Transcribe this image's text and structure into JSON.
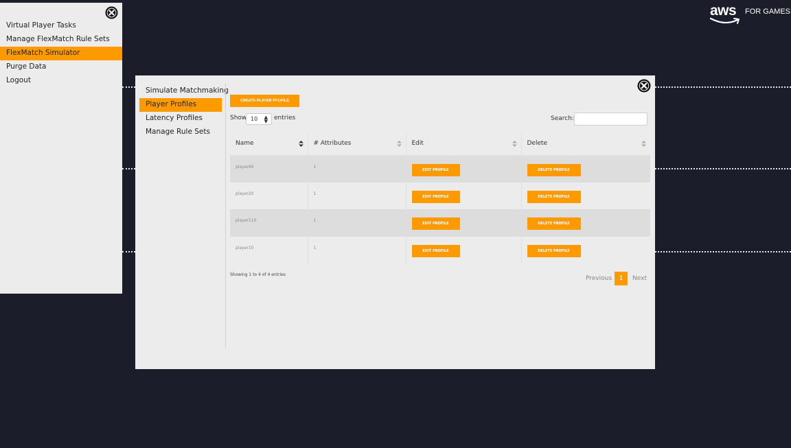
{
  "brand": {
    "logo_word": "aws",
    "tagline": "FOR GAMES"
  },
  "sidemenu": {
    "items": [
      {
        "label": "Virtual Player Tasks"
      },
      {
        "label": "Manage FlexMatch Rule Sets"
      },
      {
        "label": "FlexMatch Simulator"
      },
      {
        "label": "Purge Data"
      },
      {
        "label": "Logout"
      }
    ],
    "active_index": 2
  },
  "modal": {
    "nav": [
      {
        "label": "Simulate Matchmaking"
      },
      {
        "label": "Player Profiles"
      },
      {
        "label": "Latency Profiles"
      },
      {
        "label": "Manage Rule Sets"
      }
    ],
    "active_index": 1,
    "create_button": "CREATE PLAYER PROFILE",
    "show_label": "Show",
    "entries_per_page": "10",
    "entries_label": "entries",
    "search_label": "Search:",
    "search_value": "",
    "columns": [
      "Name",
      "# Attributes",
      "Edit",
      "Delete"
    ],
    "rows": [
      {
        "name": "player60",
        "attributes": "1",
        "edit": "EDIT PROFILE",
        "delete": "DELETE PROFILE"
      },
      {
        "name": "player20",
        "attributes": "1",
        "edit": "EDIT PROFILE",
        "delete": "DELETE PROFILE"
      },
      {
        "name": "player110",
        "attributes": "1",
        "edit": "EDIT PROFILE",
        "delete": "DELETE PROFILE"
      },
      {
        "name": "player10",
        "attributes": "1",
        "edit": "EDIT PROFILE",
        "delete": "DELETE PROFILE"
      }
    ],
    "info": "Showing 1 to 4 of 4 entries",
    "pagination": {
      "previous": "Previous",
      "current": "1",
      "next": "Next"
    }
  },
  "colors": {
    "background": "#1b1d2a",
    "panel": "#ebeceb",
    "accent": "#fd9a00"
  }
}
